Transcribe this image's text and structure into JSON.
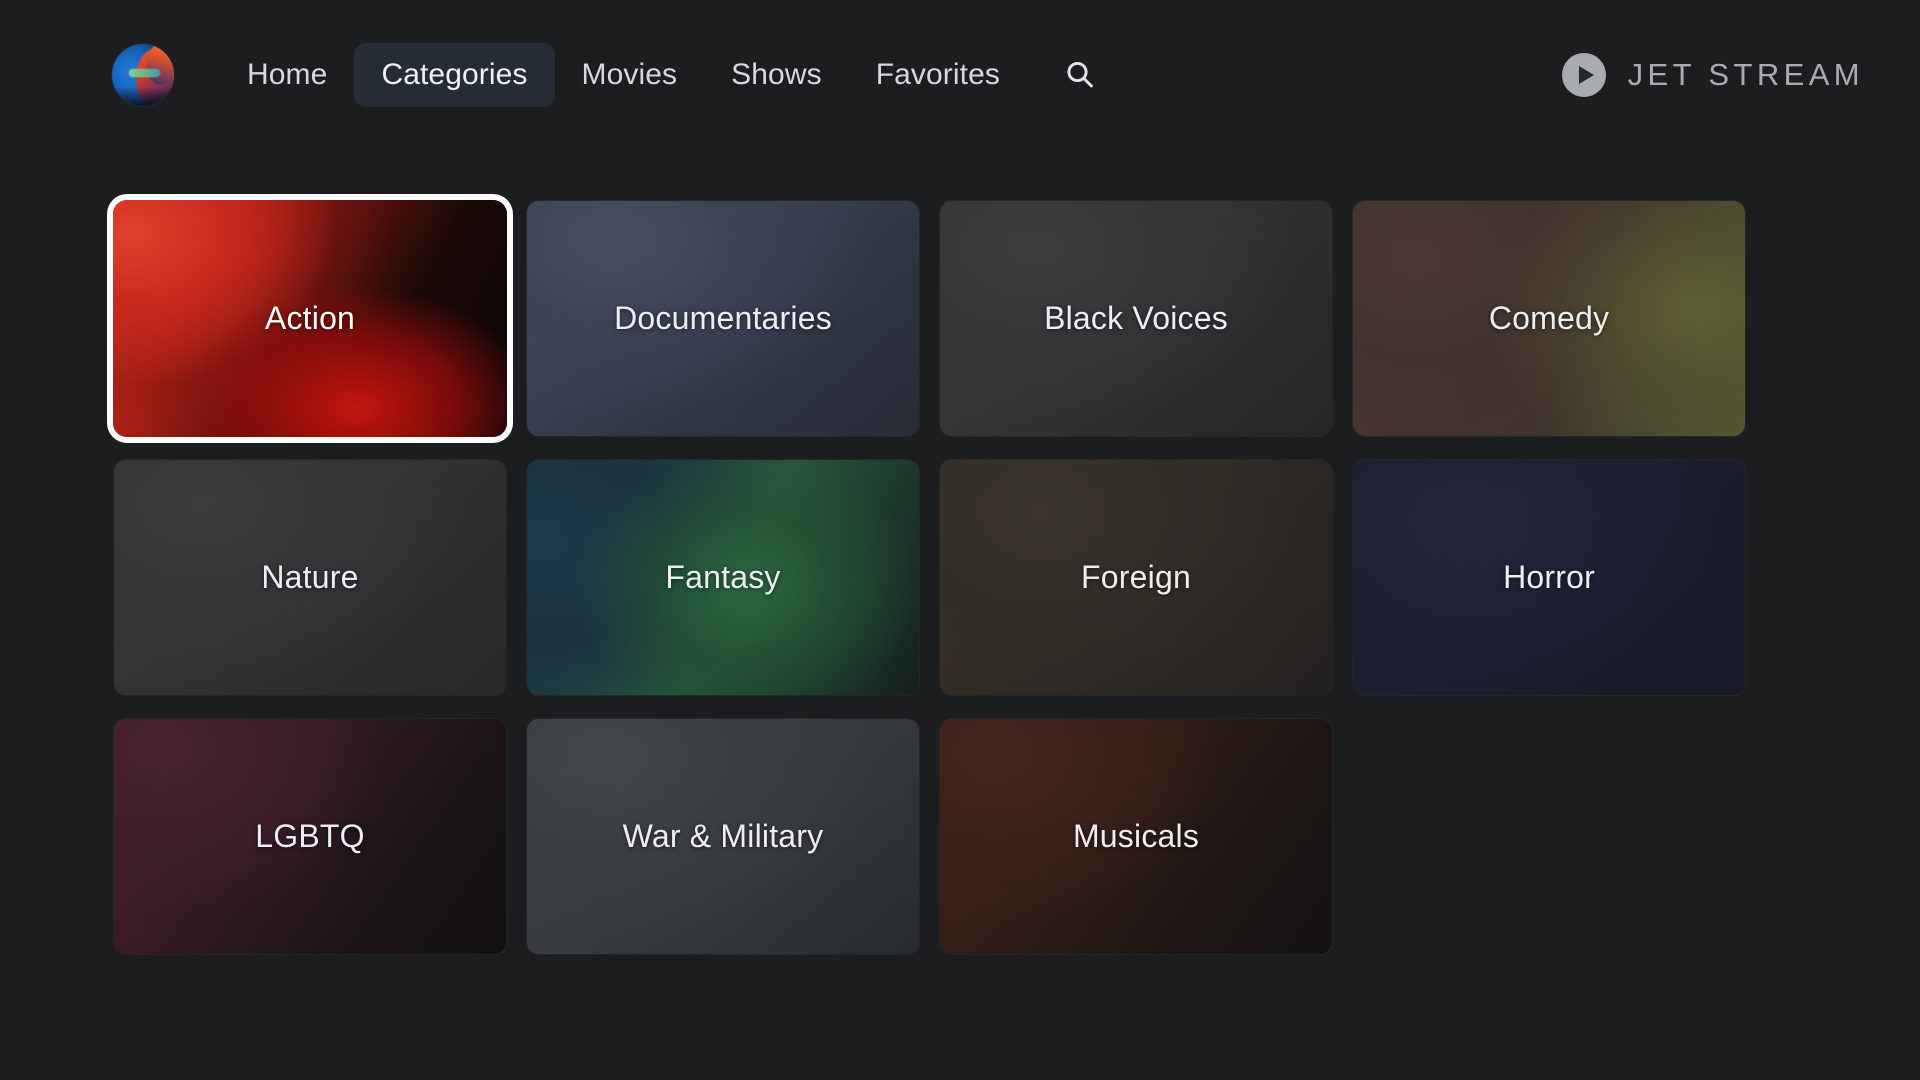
{
  "brand": {
    "name": "JET STREAM",
    "mark_icon": "play-circle-icon"
  },
  "nav": {
    "avatar_alt": "user-avatar",
    "items": [
      {
        "label": "Home",
        "active": false
      },
      {
        "label": "Categories",
        "active": true
      },
      {
        "label": "Movies",
        "active": false
      },
      {
        "label": "Shows",
        "active": false
      },
      {
        "label": "Favorites",
        "active": false
      }
    ],
    "search_icon": "search-icon"
  },
  "categories": {
    "focused_index": 0,
    "items": [
      {
        "label": "Action",
        "art": "art-action",
        "focused": true
      },
      {
        "label": "Documentaries",
        "art": "art-documentaries",
        "focused": false
      },
      {
        "label": "Black Voices",
        "art": "art-blackvoices",
        "focused": false
      },
      {
        "label": "Comedy",
        "art": "art-comedy",
        "focused": false
      },
      {
        "label": "Nature",
        "art": "art-nature",
        "focused": false
      },
      {
        "label": "Fantasy",
        "art": "art-fantasy",
        "focused": false
      },
      {
        "label": "Foreign",
        "art": "art-foreign",
        "focused": false
      },
      {
        "label": "Horror",
        "art": "art-horror",
        "focused": false
      },
      {
        "label": "LGBTQ",
        "art": "art-lgbtq",
        "focused": false
      },
      {
        "label": "War & Military",
        "art": "art-warmilitary",
        "focused": false
      },
      {
        "label": "Musicals",
        "art": "art-musicals",
        "focused": false
      }
    ]
  },
  "colors": {
    "page_background": "#1c1d1f",
    "active_tab_background": "#262c35",
    "nav_text": "#d6d8dc",
    "brand_gray": "#a9acae",
    "focus_ring": "#ffffff",
    "card_label": "#eceef1"
  }
}
